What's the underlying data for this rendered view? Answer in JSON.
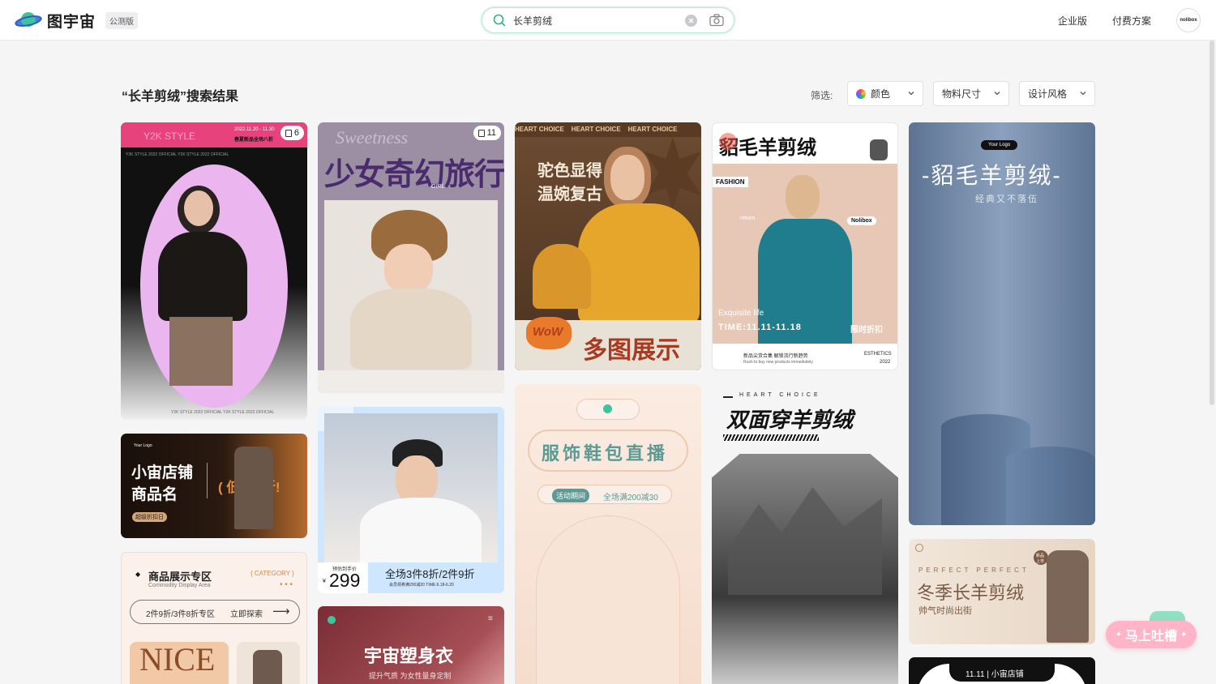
{
  "header": {
    "logo_text": "图宇宙",
    "beta_label": "公测版",
    "search": {
      "value": "长羊剪绒"
    },
    "nav": [
      {
        "label": "企业版"
      },
      {
        "label": "付费方案"
      }
    ],
    "avatar_text": "nolibox"
  },
  "results": {
    "title": "“长羊剪绒”搜索结果",
    "filter_label": "筛选:",
    "filters": [
      {
        "label": "颜色"
      },
      {
        "label": "物料尺寸"
      },
      {
        "label": "设计风格"
      }
    ]
  },
  "cards": {
    "c1": {
      "brand": "Y2K STYLE",
      "meta": "2022.11.20 - 11.30",
      "meta2": "春夏新品全场八折",
      "sub": "Y2K STYLE 2022 OFFICIAL  Y2K STYLE 2022 OFFICIAL",
      "foot": "Y2K STYLE 2022 OFFICIAL  Y2K STYLE 2022 OFFICIAL",
      "count": "6"
    },
    "c2": {
      "script": "Sweetness",
      "title": "少女奇幻旅行",
      "tag": "GIRL",
      "count": "11"
    },
    "c3": {
      "top": "HEART CHOICE    HEART CHOICE    HEART CHOICE",
      "title1": "驼色显得",
      "title2": "温婉复古",
      "wow": "WoW",
      "bottom": "多图展示"
    },
    "c4": {
      "title": "貂毛羊剪绒",
      "fashion": "FASHION",
      "return": "return",
      "brand": "Nolibox",
      "life": "Exquisite life",
      "time": "TIME:11.11-11.18",
      "limit": "限时折扣",
      "foot1": "新品尖货合集 解锁流行新趋势",
      "foot2": "Rush to buy new products immediately",
      "foot3": "ESTHETICS",
      "foot4": "2022"
    },
    "c5": {
      "logo": "Your Logo",
      "title": "-貂毛羊剪绒-",
      "sub": "经典又不落伍"
    },
    "c6": {
      "logo": "Your Logo",
      "title1": "小宙店铺",
      "title2": "商品名",
      "slogan": "( 低至5折!",
      "tag": "超级折扣日"
    },
    "c7": {
      "label": "预估到手价",
      "price": "299",
      "currency": "¥",
      "promo": "全场3件8折/2件9折",
      "promo_sub": "会员领券满200减20    TIME:6.18-6.20"
    },
    "c8": {
      "title": "服饰鞋包直播",
      "pill1": "活动期间",
      "pill2": "全场满200减30"
    },
    "c9": {
      "top": "HEART CHOICE",
      "title": "双面穿羊剪绒"
    },
    "c10": {
      "title": "冬季长羊剪绒",
      "sub": "帅气时尚出街",
      "spaced": "PERFECT  PERFECT",
      "badge": "新品上市"
    },
    "c11": {
      "title": "商品展示专区",
      "en": "Commodity Display Area",
      "cat": "{ CATEGORY }",
      "bar": "2件9折/3件8折专区",
      "btn": "立即探索",
      "nice": "NICE"
    },
    "c12": {
      "title": "宇宙塑身衣",
      "sub": "提升气质 为女性量身定制"
    },
    "c13": {
      "text": "11.11 | 小宙店铺"
    }
  },
  "feedback": {
    "label": "马上吐槽"
  },
  "colors": {
    "accent": "#2fb388",
    "feedback": "#ffb4c8",
    "background": "#f5f5f6"
  }
}
